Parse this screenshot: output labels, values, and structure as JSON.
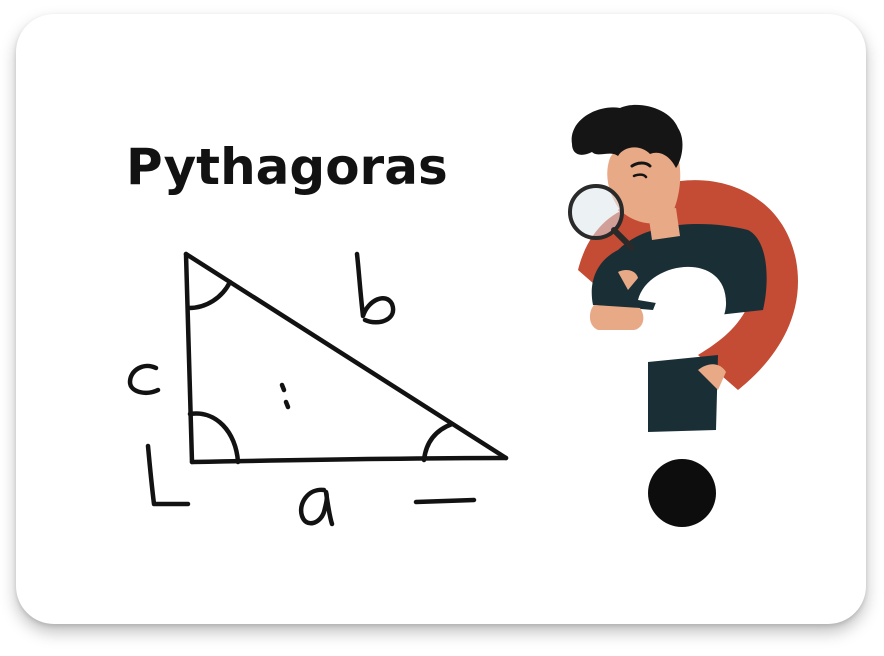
{
  "title": "Pythagoras",
  "triangle_labels": {
    "side_b": "b",
    "side_c": "c",
    "side_a": "a"
  },
  "colors": {
    "ink": "#121212",
    "question_mark_red": "#c44b34",
    "shirt": "#1a2f35",
    "skin": "#e8a987",
    "hair": "#151515"
  },
  "icons": [
    "triangle-diagram",
    "detective-figure",
    "magnifying-glass-icon",
    "question-mark-icon"
  ]
}
